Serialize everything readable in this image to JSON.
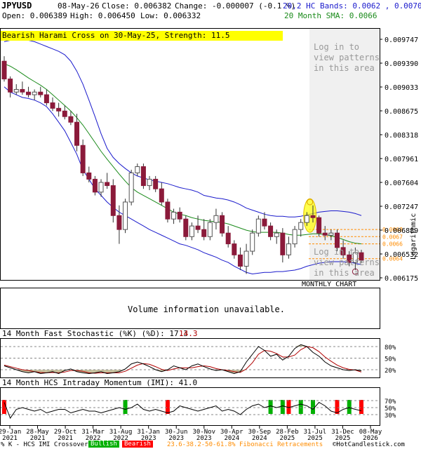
{
  "header": {
    "symbol": "JPYUSD",
    "date": "08-May-26",
    "close": "Close: 0.006382",
    "change": "Change: -0.000007 (-0.1 %)",
    "open": "Open: 0.006389",
    "high": "High: 0.006450",
    "low": "Low: 0.006332",
    "bands_label": "20,2 HC Bands: 0.0062 , 0.0070",
    "sma_label": "20 Month SMA: 0.0066"
  },
  "pattern_banner": "Bearish Harami Cross on 30-May-25, Strength: 11.5",
  "login_text": [
    "Log in to",
    "view patterns",
    "in this area"
  ],
  "monthly_label": "MONTHLY CHART",
  "volume_text": "Volume information unavailable.",
  "stoch_title": "14 Month Fast Stochastic (%K) (%D): 17.3",
  "stoch_d_value": "14.3",
  "imi_title": "14 Month HCS Intraday Momentum (IMI): 41.0",
  "footer": {
    "legend_k": "% K - HCS IMI Crossover:",
    "bullish": "Bullish",
    "bearish": "Bearish",
    "fib": "23.6-38.2-50-61.8% Fibonacci Retracements",
    "site": "©HotCandlestick.com"
  },
  "colors": {
    "candle": "#8b1a3a",
    "hollow_edge": "#555555",
    "sma": "#1a8a1a",
    "band": "#1a1acc",
    "banner": "#ffff00",
    "bull": "#00b000",
    "bear": "#ff0000",
    "fib": "#ff8c00",
    "overbought_fill": "#c9c3a0",
    "login_area": "#f0f0f0"
  },
  "chart_data": {
    "type": "candlestick",
    "scale": "logarithmic",
    "ylim": [
      0.00615,
      0.0101
    ],
    "price_ticks": [
      "0.009747",
      "0.009390",
      "0.009033",
      "0.008675",
      "0.008318",
      "0.007961",
      "0.007604",
      "0.007247",
      "0.006889",
      "0.006532",
      "0.006175"
    ],
    "fib_levels": [
      0.0068,
      0.0067,
      0.0066,
      0.0064
    ],
    "fib_labels": [
      "0.0068",
      "0.0067",
      "0.0066",
      "0.0064"
    ],
    "x_labels": [
      {
        "d": "29-Jan",
        "y": "2021"
      },
      {
        "d": "28-May",
        "y": "2021"
      },
      {
        "d": "29-Oct",
        "y": "2021"
      },
      {
        "d": "31-Mar",
        "y": "2022"
      },
      {
        "d": "31-Aug",
        "y": "2022"
      },
      {
        "d": "31-Jan",
        "y": "2023"
      },
      {
        "d": "30-Jun",
        "y": "2023"
      },
      {
        "d": "30-Nov",
        "y": "2023"
      },
      {
        "d": "30-Apr",
        "y": "2024"
      },
      {
        "d": "30-Sep",
        "y": "2024"
      },
      {
        "d": "28-Feb",
        "y": "2025"
      },
      {
        "d": "31-Jul",
        "y": "2025"
      },
      {
        "d": "31-Dec",
        "y": "2025"
      },
      {
        "d": "08-May",
        "y": "2026"
      }
    ],
    "candles": [
      [
        0.00965,
        0.00975,
        0.00925,
        0.0093
      ],
      [
        0.0093,
        0.00935,
        0.00895,
        0.00905
      ],
      [
        0.00905,
        0.0092,
        0.009,
        0.0091
      ],
      [
        0.0091,
        0.00925,
        0.009,
        0.00905
      ],
      [
        0.00905,
        0.00915,
        0.00895,
        0.009
      ],
      [
        0.009,
        0.0091,
        0.0089,
        0.00905
      ],
      [
        0.00905,
        0.00915,
        0.00895,
        0.009
      ],
      [
        0.009,
        0.0091,
        0.0088,
        0.00885
      ],
      [
        0.00885,
        0.00895,
        0.0087,
        0.00875
      ],
      [
        0.00875,
        0.00885,
        0.0086,
        0.0087
      ],
      [
        0.0087,
        0.0088,
        0.00855,
        0.0086
      ],
      [
        0.0086,
        0.0087,
        0.00845,
        0.0085
      ],
      [
        0.0085,
        0.00865,
        0.008,
        0.0081
      ],
      [
        0.0081,
        0.0082,
        0.0076,
        0.00765
      ],
      [
        0.00765,
        0.00775,
        0.0075,
        0.00755
      ],
      [
        0.00755,
        0.0076,
        0.0073,
        0.00735
      ],
      [
        0.00735,
        0.00755,
        0.00728,
        0.0075
      ],
      [
        0.0075,
        0.00765,
        0.0074,
        0.00745
      ],
      [
        0.00745,
        0.00755,
        0.0069,
        0.007
      ],
      [
        0.007,
        0.00715,
        0.0066,
        0.0068
      ],
      [
        0.0068,
        0.00725,
        0.00675,
        0.0072
      ],
      [
        0.0072,
        0.0077,
        0.00715,
        0.00765
      ],
      [
        0.00765,
        0.0078,
        0.0076,
        0.00775
      ],
      [
        0.00775,
        0.0078,
        0.0074,
        0.00745
      ],
      [
        0.00745,
        0.0076,
        0.00738,
        0.00755
      ],
      [
        0.00755,
        0.0076,
        0.00735,
        0.0074
      ],
      [
        0.0074,
        0.0075,
        0.00715,
        0.0072
      ],
      [
        0.0072,
        0.00725,
        0.0069,
        0.00695
      ],
      [
        0.00695,
        0.0071,
        0.00688,
        0.00705
      ],
      [
        0.00705,
        0.00712,
        0.0069,
        0.00695
      ],
      [
        0.00695,
        0.007,
        0.00665,
        0.0067
      ],
      [
        0.0067,
        0.0069,
        0.00665,
        0.00685
      ],
      [
        0.00685,
        0.007,
        0.00675,
        0.0068
      ],
      [
        0.0068,
        0.00695,
        0.00665,
        0.0067
      ],
      [
        0.0067,
        0.00695,
        0.00665,
        0.0069
      ],
      [
        0.0069,
        0.0071,
        0.0068,
        0.007
      ],
      [
        0.007,
        0.00705,
        0.0067,
        0.00675
      ],
      [
        0.00675,
        0.00685,
        0.00655,
        0.0066
      ],
      [
        0.0066,
        0.00665,
        0.0064,
        0.00645
      ],
      [
        0.00645,
        0.00655,
        0.00625,
        0.0063
      ],
      [
        0.0063,
        0.0066,
        0.0062,
        0.0065
      ],
      [
        0.0065,
        0.0068,
        0.00645,
        0.00675
      ],
      [
        0.00675,
        0.007,
        0.0067,
        0.00695
      ],
      [
        0.00695,
        0.00705,
        0.0068,
        0.00685
      ],
      [
        0.00685,
        0.0069,
        0.00665,
        0.0067
      ],
      [
        0.0067,
        0.0068,
        0.0066,
        0.00675
      ],
      [
        0.00675,
        0.00682,
        0.00635,
        0.00645
      ],
      [
        0.00645,
        0.0067,
        0.0064,
        0.0066
      ],
      [
        0.0066,
        0.00685,
        0.00655,
        0.0068
      ],
      [
        0.0068,
        0.00695,
        0.0067,
        0.0069
      ],
      [
        0.0069,
        0.00705,
        0.00685,
        0.007
      ],
      [
        0.007,
        0.00715,
        0.0069,
        0.00697
      ],
      [
        0.00697,
        0.007,
        0.0067,
        0.00675
      ],
      [
        0.00675,
        0.00685,
        0.00665,
        0.00672
      ],
      [
        0.00672,
        0.0068,
        0.00665,
        0.00675
      ],
      [
        0.00675,
        0.0068,
        0.0065,
        0.00655
      ],
      [
        0.00655,
        0.00665,
        0.0064,
        0.00645
      ],
      [
        0.00645,
        0.0065,
        0.0063,
        0.00635
      ],
      [
        0.00635,
        0.00655,
        0.00625,
        0.00648
      ],
      [
        0.00648,
        0.00652,
        0.00634,
        0.00638
      ]
    ],
    "sma": [
      0.0096,
      0.00955,
      0.00948,
      0.0094,
      0.00932,
      0.00925,
      0.00918,
      0.0091,
      0.009,
      0.0089,
      0.0088,
      0.0087,
      0.00858,
      0.00845,
      0.0083,
      0.00815,
      0.008,
      0.00787,
      0.00775,
      0.00763,
      0.00752,
      0.00742,
      0.00735,
      0.0073,
      0.00725,
      0.0072,
      0.00715,
      0.0071,
      0.00705,
      0.00702,
      0.007,
      0.00697,
      0.00695,
      0.00693,
      0.00692,
      0.00691,
      0.0069,
      0.00688,
      0.00685,
      0.00682,
      0.00679,
      0.00677,
      0.00676,
      0.00676,
      0.00676,
      0.00676,
      0.00675,
      0.00673,
      0.00672,
      0.00672,
      0.00673,
      0.00674,
      0.00674,
      0.00673,
      0.00671,
      0.00669,
      0.00666,
      0.00663,
      0.00661,
      0.0066
    ],
    "band_upper": [
      0.01005,
      0.01008,
      0.0101,
      0.0101,
      0.01008,
      0.01005,
      0.01,
      0.00995,
      0.0099,
      0.00985,
      0.00978,
      0.00965,
      0.00945,
      0.0092,
      0.0089,
      0.0086,
      0.0083,
      0.00805,
      0.0079,
      0.0078,
      0.00772,
      0.00765,
      0.0076,
      0.00757,
      0.00754,
      0.00752,
      0.0075,
      0.00748,
      0.00745,
      0.00742,
      0.0074,
      0.00738,
      0.00735,
      0.0073,
      0.00728,
      0.00726,
      0.00725,
      0.00723,
      0.0072,
      0.00716,
      0.00711,
      0.00708,
      0.00705,
      0.00702,
      0.007,
      0.00699,
      0.00699,
      0.00698,
      0.00698,
      0.00699,
      0.00701,
      0.00703,
      0.00705,
      0.00706,
      0.00707,
      0.00707,
      0.00706,
      0.00705,
      0.00703,
      0.007
    ],
    "band_lower": [
      0.00915,
      0.00905,
      0.009,
      0.00895,
      0.00893,
      0.0089,
      0.00885,
      0.00878,
      0.00865,
      0.0085,
      0.00835,
      0.00815,
      0.00795,
      0.0077,
      0.00755,
      0.0074,
      0.0073,
      0.0072,
      0.00712,
      0.00705,
      0.007,
      0.00695,
      0.0069,
      0.00685,
      0.0068,
      0.00676,
      0.00672,
      0.00668,
      0.00664,
      0.0066,
      0.00658,
      0.00655,
      0.00652,
      0.00648,
      0.00645,
      0.00642,
      0.00638,
      0.00635,
      0.0063,
      0.00626,
      0.00622,
      0.0062,
      0.00621,
      0.00622,
      0.00622,
      0.00623,
      0.00623,
      0.00624,
      0.00625,
      0.00627,
      0.0063,
      0.00632,
      0.00634,
      0.00635,
      0.00636,
      0.00636,
      0.00636,
      0.00635,
      0.00634,
      0.00632
    ],
    "stoch_k": [
      30,
      25,
      20,
      15,
      12,
      15,
      10,
      12,
      15,
      10,
      18,
      22,
      15,
      12,
      10,
      12,
      15,
      10,
      12,
      15,
      22,
      35,
      40,
      35,
      28,
      20,
      15,
      20,
      30,
      25,
      20,
      30,
      35,
      28,
      22,
      18,
      20,
      15,
      10,
      15,
      40,
      60,
      80,
      70,
      55,
      60,
      45,
      55,
      75,
      85,
      80,
      65,
      55,
      40,
      30,
      25,
      20,
      18,
      20,
      17
    ],
    "stoch_d": [
      32,
      28,
      24,
      20,
      18,
      15,
      13,
      12,
      13,
      12,
      14,
      18,
      18,
      16,
      12,
      11,
      12,
      12,
      12,
      12,
      16,
      24,
      32,
      36,
      34,
      28,
      21,
      18,
      22,
      25,
      25,
      25,
      28,
      30,
      28,
      23,
      20,
      18,
      15,
      13,
      22,
      38,
      60,
      70,
      68,
      62,
      53,
      53,
      58,
      72,
      80,
      77,
      67,
      53,
      42,
      32,
      25,
      21,
      19,
      14
    ],
    "imi": [
      65,
      20,
      45,
      50,
      45,
      40,
      45,
      35,
      40,
      45,
      45,
      35,
      40,
      45,
      40,
      40,
      35,
      40,
      45,
      50,
      45,
      50,
      60,
      45,
      40,
      45,
      40,
      35,
      40,
      55,
      50,
      45,
      40,
      45,
      50,
      55,
      40,
      45,
      40,
      30,
      45,
      55,
      60,
      50,
      55,
      50,
      55,
      50,
      55,
      60,
      55,
      45,
      65,
      55,
      40,
      35,
      45,
      50,
      45,
      41
    ],
    "crossovers": [
      {
        "i": 0,
        "t": "bear"
      },
      {
        "i": 20,
        "t": "bull"
      },
      {
        "i": 27,
        "t": "bear"
      },
      {
        "i": 44,
        "t": "bull"
      },
      {
        "i": 46,
        "t": "bull"
      },
      {
        "i": 47,
        "t": "bear"
      },
      {
        "i": 49,
        "t": "bull"
      },
      {
        "i": 51,
        "t": "bull"
      },
      {
        "i": 55,
        "t": "bear"
      },
      {
        "i": 57,
        "t": "bull"
      },
      {
        "i": 59,
        "t": "bear"
      }
    ],
    "stoch_ticks": [
      "80%",
      "50%",
      "20%"
    ],
    "imi_ticks": [
      "70%",
      "50%",
      "30%"
    ],
    "y_axis_label": "Logarithmic"
  }
}
